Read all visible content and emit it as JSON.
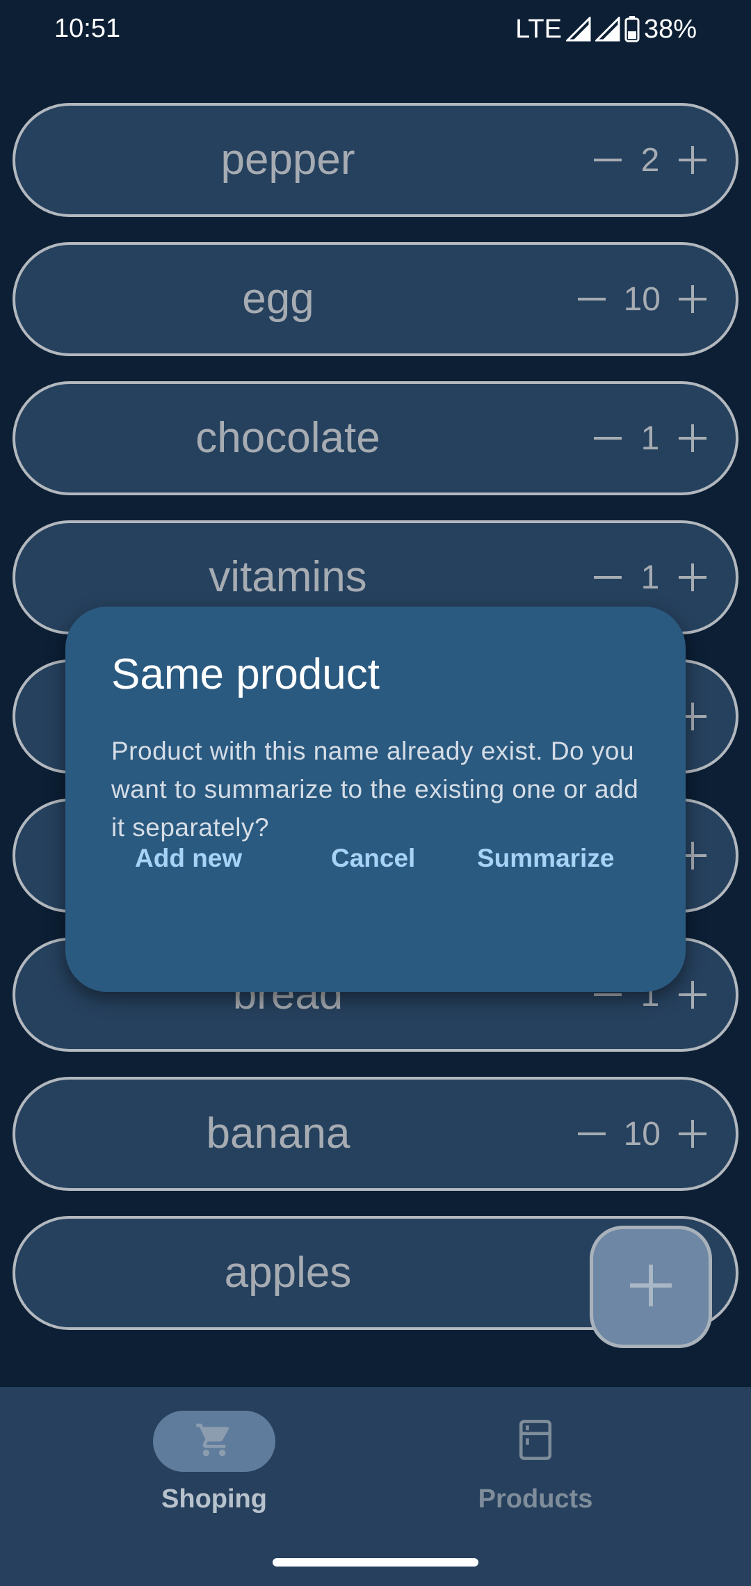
{
  "status_bar": {
    "time": "10:51",
    "network": "LTE",
    "battery": "38%"
  },
  "items": [
    {
      "name": "pepper",
      "qty": "2"
    },
    {
      "name": "egg",
      "qty": "10"
    },
    {
      "name": "chocolate",
      "qty": "1"
    },
    {
      "name": "vitamins",
      "qty": "1"
    },
    {
      "name": "",
      "qty": ""
    },
    {
      "name": "",
      "qty": ""
    },
    {
      "name": "bread",
      "qty": "1"
    },
    {
      "name": "banana",
      "qty": "10"
    },
    {
      "name": "apples",
      "qty": ""
    }
  ],
  "dialog": {
    "title": "Same product",
    "message": "Product with this name already exist. Do you want to summarize to the existing one or add it separately?",
    "add_new_label": "Add new",
    "cancel_label": "Cancel",
    "summarize_label": "Summarize"
  },
  "bottom_nav": {
    "shopping_label": "Shoping",
    "products_label": "Products",
    "active": "shopping"
  },
  "colors": {
    "background": "#0c1f35",
    "item_fill": "#26415e",
    "dialog": "#2b5a80",
    "dialog_action": "#a7d3f7",
    "fab": "#6d87a4"
  }
}
